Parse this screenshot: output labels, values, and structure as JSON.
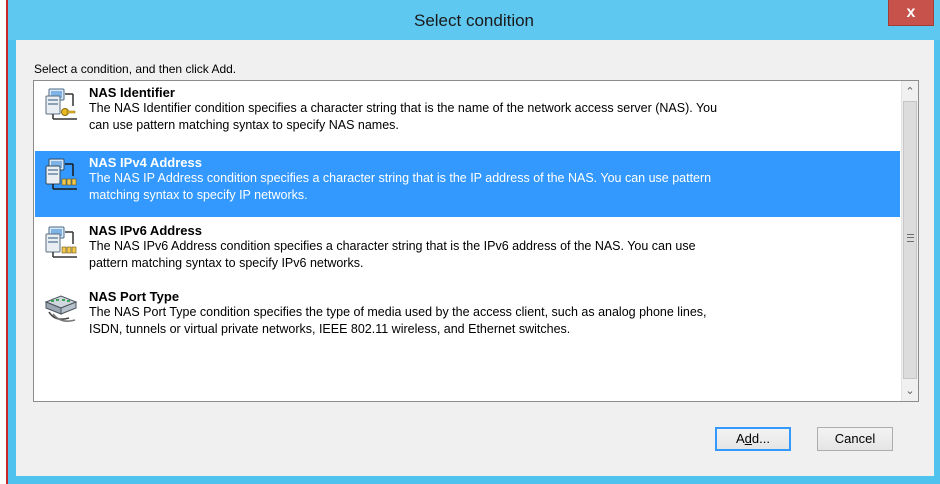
{
  "window": {
    "title": "Select condition",
    "close_label": "x"
  },
  "instruction": "Select a condition, and then click Add.",
  "conditions": [
    {
      "name": "NAS Identifier",
      "description_line1": "The NAS Identifier condition specifies a character string that is the name of the network access server (NAS). You",
      "description_line2": "can use pattern matching syntax to specify NAS names.",
      "icon": "network-server-key-icon",
      "selected": false
    },
    {
      "name": "NAS IPv4 Address",
      "description_line1": "The NAS IP Address condition specifies a character string that is the IP address of the NAS. You can use pattern",
      "description_line2": "matching syntax to specify IP networks.",
      "icon": "network-server-ip-icon",
      "selected": true
    },
    {
      "name": "NAS IPv6 Address",
      "description_line1": "The NAS IPv6 Address condition specifies a character string that is the IPv6 address of the NAS. You can use",
      "description_line2": "pattern matching syntax to specify IPv6 networks.",
      "icon": "network-server-ip-icon",
      "selected": false
    },
    {
      "name": "NAS Port Type",
      "description_line1": "The NAS Port Type condition specifies the type of media used by the access client, such as analog phone lines,",
      "description_line2": "ISDN, tunnels or virtual private networks, IEEE 802.11 wireless, and Ethernet switches.",
      "icon": "network-switch-icon",
      "selected": false
    }
  ],
  "buttons": {
    "add_prefix": "A",
    "add_mnemonic": "d",
    "add_suffix": "d...",
    "cancel": "Cancel"
  },
  "colors": {
    "selection": "#3399ff",
    "titlebar": "#5ec8f0",
    "close": "#c7514b"
  }
}
